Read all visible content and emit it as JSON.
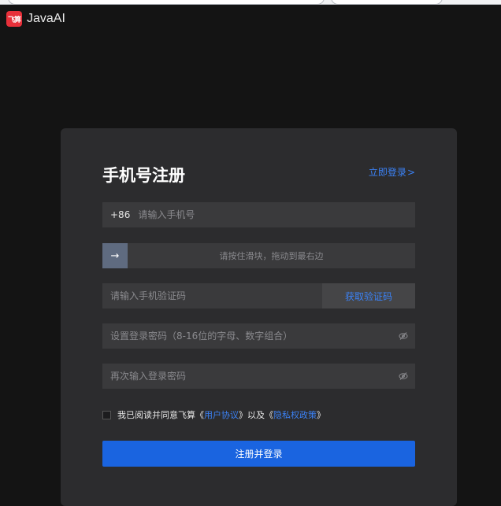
{
  "brand": {
    "logo_text": "飞算",
    "name": "JavaAI"
  },
  "register": {
    "title": "手机号注册",
    "login_link": "立即登录",
    "login_chevron": ">",
    "phone": {
      "prefix": "+86",
      "placeholder": "请输入手机号",
      "value": ""
    },
    "slider": {
      "handle_icon": "→",
      "text": "请按住滑块，拖动到最右边"
    },
    "code": {
      "placeholder": "请输入手机验证码",
      "value": "",
      "button_label": "获取验证码"
    },
    "password": {
      "placeholder": "设置登录密码（8-16位的字母、数字组合）",
      "value": ""
    },
    "confirm_password": {
      "placeholder": "再次输入登录密码",
      "value": ""
    },
    "agreement": {
      "prefix": "我已阅读并同意飞算《",
      "user_agreement": "用户协议",
      "middle": "》以及《",
      "privacy_policy": "隐私权政策",
      "suffix": "》",
      "checked": false
    },
    "submit_label": "注册并登录"
  },
  "colors": {
    "background": "#141414",
    "card": "#2c2c2e",
    "field": "#3a3a3c",
    "link": "#3b82f6",
    "primary_button": "#1a64e0",
    "logo": "#e8303a"
  },
  "icons": {
    "slider_handle": "arrow-right-icon",
    "password_toggle": "eye-off-icon"
  }
}
